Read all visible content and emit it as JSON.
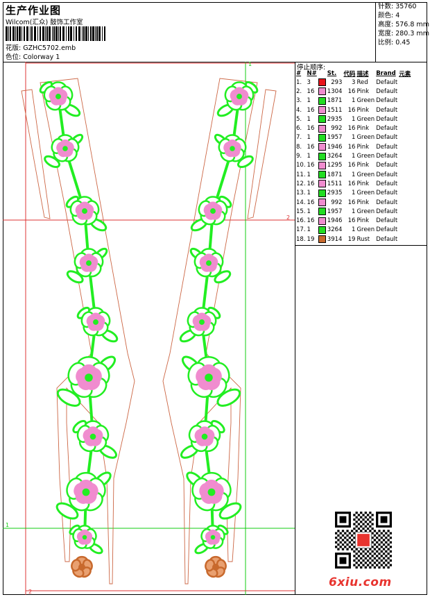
{
  "header": {
    "title": "生产作业图",
    "company": "Wilcom(汇众) 鼓饰工作室",
    "pattern_line": "花版:  GZHC5702.emb",
    "colorway_line": "色位:  Colorway 1"
  },
  "stats": [
    "针数: 35760",
    "颜色: 4",
    "高度: 576.8 mm",
    "宽度: 280.3 mm",
    "比例: 0.45"
  ],
  "stop_sequence": {
    "title": "停止顺序:",
    "headers": [
      "#",
      "N#",
      "St.",
      "代码",
      "描述",
      "Brand",
      "元素"
    ],
    "rows": [
      {
        "idx": "1.",
        "n": "3",
        "color": "#e8141c",
        "st": "293",
        "code": "3",
        "desc": "Red",
        "brand": "Default"
      },
      {
        "idx": "2.",
        "n": "16",
        "color": "#f08ccf",
        "st": "1304",
        "code": "16",
        "desc": "Pink",
        "brand": "Default"
      },
      {
        "idx": "3.",
        "n": "1",
        "color": "#22dd22",
        "st": "1871",
        "code": "1",
        "desc": "Green",
        "brand": "Default"
      },
      {
        "idx": "4.",
        "n": "16",
        "color": "#f08ccf",
        "st": "1511",
        "code": "16",
        "desc": "Pink",
        "brand": "Default"
      },
      {
        "idx": "5.",
        "n": "1",
        "color": "#22dd22",
        "st": "2935",
        "code": "1",
        "desc": "Green",
        "brand": "Default"
      },
      {
        "idx": "6.",
        "n": "16",
        "color": "#f08ccf",
        "st": "992",
        "code": "16",
        "desc": "Pink",
        "brand": "Default"
      },
      {
        "idx": "7.",
        "n": "1",
        "color": "#22dd22",
        "st": "1957",
        "code": "1",
        "desc": "Green",
        "brand": "Default"
      },
      {
        "idx": "8.",
        "n": "16",
        "color": "#f08ccf",
        "st": "1946",
        "code": "16",
        "desc": "Pink",
        "brand": "Default"
      },
      {
        "idx": "9.",
        "n": "1",
        "color": "#22dd22",
        "st": "3264",
        "code": "1",
        "desc": "Green",
        "brand": "Default"
      },
      {
        "idx": "10.",
        "n": "16",
        "color": "#f08ccf",
        "st": "1295",
        "code": "16",
        "desc": "Pink",
        "brand": "Default"
      },
      {
        "idx": "11.",
        "n": "1",
        "color": "#22dd22",
        "st": "1871",
        "code": "1",
        "desc": "Green",
        "brand": "Default"
      },
      {
        "idx": "12.",
        "n": "16",
        "color": "#f08ccf",
        "st": "1511",
        "code": "16",
        "desc": "Pink",
        "brand": "Default"
      },
      {
        "idx": "13.",
        "n": "1",
        "color": "#22dd22",
        "st": "2935",
        "code": "1",
        "desc": "Green",
        "brand": "Default"
      },
      {
        "idx": "14.",
        "n": "16",
        "color": "#f08ccf",
        "st": "992",
        "code": "16",
        "desc": "Pink",
        "brand": "Default"
      },
      {
        "idx": "15.",
        "n": "1",
        "color": "#22dd22",
        "st": "1957",
        "code": "1",
        "desc": "Green",
        "brand": "Default"
      },
      {
        "idx": "16.",
        "n": "16",
        "color": "#f08ccf",
        "st": "1946",
        "code": "16",
        "desc": "Pink",
        "brand": "Default"
      },
      {
        "idx": "17.",
        "n": "1",
        "color": "#22dd22",
        "st": "3264",
        "code": "1",
        "desc": "Green",
        "brand": "Default"
      },
      {
        "idx": "18.",
        "n": "19",
        "color": "#c8692d",
        "st": "3914",
        "code": "19",
        "desc": "Rust",
        "brand": "Default"
      }
    ]
  },
  "guides": {
    "v1": "1",
    "h2": "2",
    "h1": "1",
    "v2": "2"
  },
  "watermark": "6xiu.com",
  "colors": {
    "red_guide": "#d33",
    "green_guide": "#1c1",
    "lace_green": "#22ee22",
    "lace_pink": "#f08ccf",
    "rust": "#c8692d"
  }
}
